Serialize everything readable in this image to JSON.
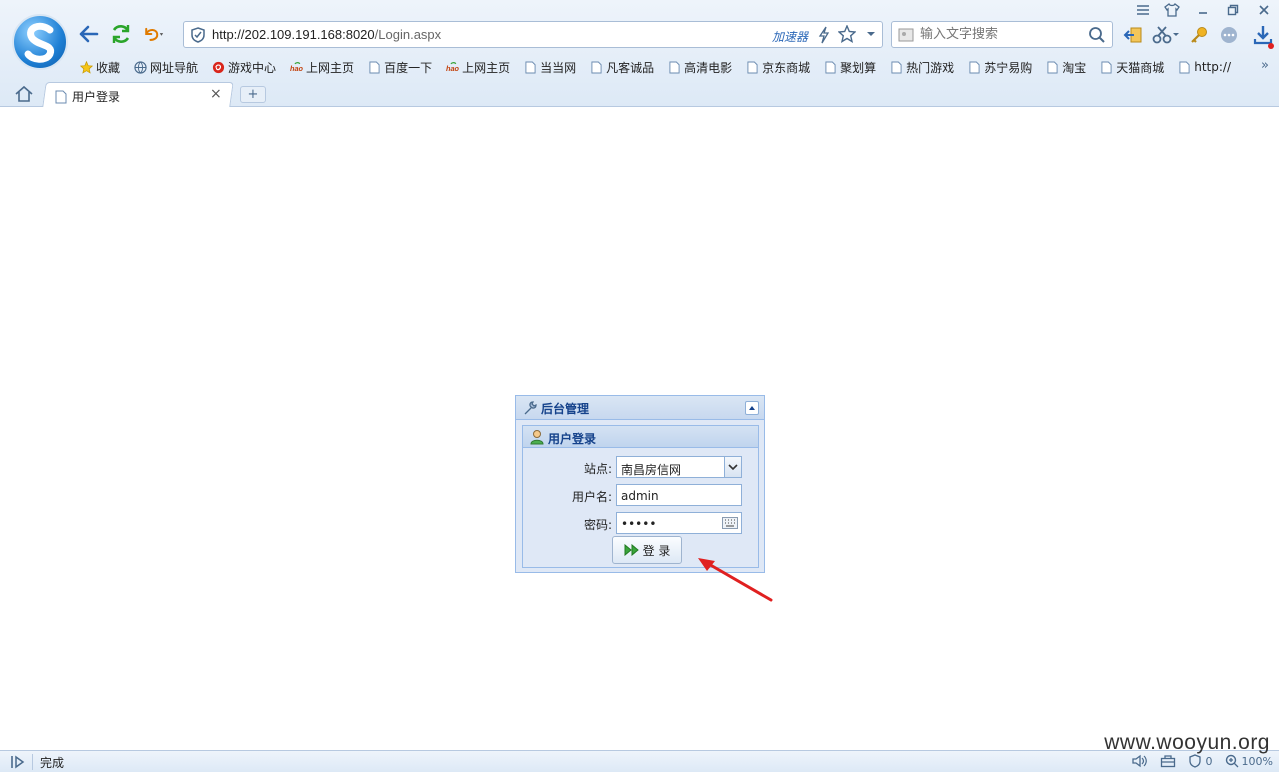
{
  "browser": {
    "url_host": "http://202.109.191.168:8020",
    "url_path": "/Login.aspx",
    "accelerator_label": "加速器",
    "search_placeholder": "输入文字搜索"
  },
  "bookmarks": [
    {
      "label": "收藏",
      "icon": "star-icon"
    },
    {
      "label": "网址导航",
      "icon": "globe-icon"
    },
    {
      "label": "游戏中心",
      "icon": "game-icon"
    },
    {
      "label": "上网主页",
      "icon": "hao-icon"
    },
    {
      "label": "百度一下",
      "icon": "page-icon"
    },
    {
      "label": "上网主页",
      "icon": "hao-icon"
    },
    {
      "label": "当当网",
      "icon": "page-icon"
    },
    {
      "label": "凡客诚品",
      "icon": "page-icon"
    },
    {
      "label": "高清电影",
      "icon": "page-icon"
    },
    {
      "label": "京东商城",
      "icon": "page-icon"
    },
    {
      "label": "聚划算",
      "icon": "page-icon"
    },
    {
      "label": "热门游戏",
      "icon": "page-icon"
    },
    {
      "label": "苏宁易购",
      "icon": "page-icon"
    },
    {
      "label": "淘宝",
      "icon": "page-icon"
    },
    {
      "label": "天猫商城",
      "icon": "page-icon"
    },
    {
      "label": "http://",
      "icon": "page-icon"
    }
  ],
  "tab": {
    "title": "用户登录"
  },
  "panel": {
    "title": "后台管理",
    "fieldset_title": "用户登录",
    "site_label": "站点:",
    "site_value": "南昌房信网",
    "username_label": "用户名:",
    "username_value": "admin",
    "password_label": "密码:",
    "password_mask": "•••••",
    "login_button": "登 录"
  },
  "status": {
    "text": "完成",
    "blocked_count": "0",
    "zoom": "100%"
  },
  "watermark": "www.wooyun.org",
  "colors": {
    "panel_title": "#15428b",
    "panel_bg": "#dfe8f6",
    "panel_border": "#99bbe8",
    "arrow": "#e02020"
  }
}
